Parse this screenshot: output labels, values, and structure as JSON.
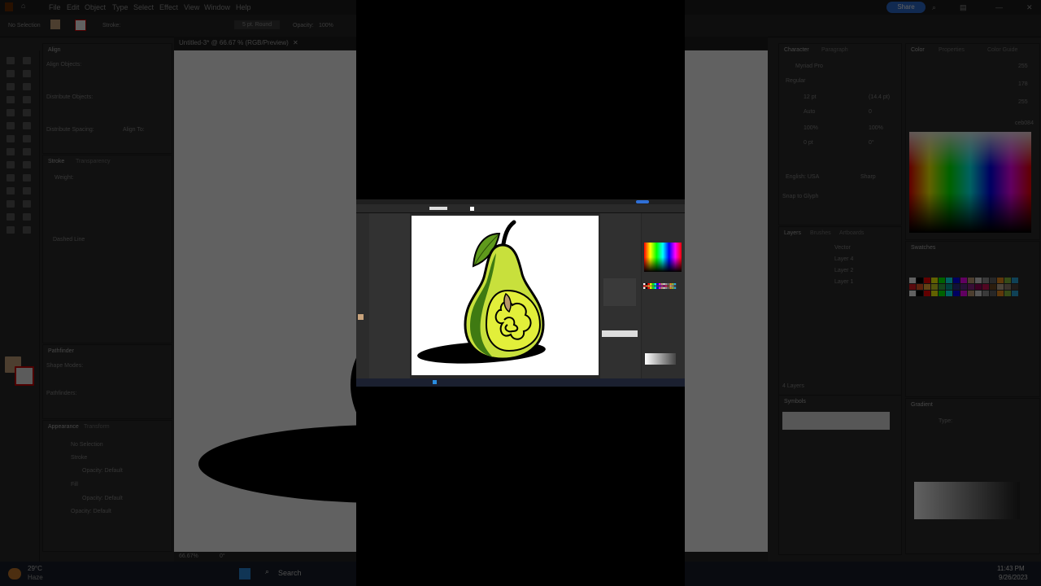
{
  "app": {
    "menu": [
      "File",
      "Edit",
      "Object",
      "Type",
      "Select",
      "Effect",
      "View",
      "Window",
      "Help"
    ],
    "share_label": "Share",
    "doc_tab": "Untitled-3* @ 66.67 % (RGB/Preview)",
    "selection_label": "No Selection",
    "stroke_label": "Stroke:",
    "brush_label": "5 pt. Round",
    "opacity_label": "Opacity:",
    "opacity_value": "100%"
  },
  "left_panels": {
    "align": {
      "title": "Align",
      "align_objects": "Align Objects:",
      "distribute_objects": "Distribute Objects:",
      "distribute_spacing": "Distribute Spacing:",
      "align_to": "Align To:"
    },
    "stroke": {
      "title": "Stroke",
      "tab2": "Transparency",
      "weight": "Weight:",
      "dashed_line": "Dashed Line"
    },
    "pathfinder": {
      "title": "Pathfinder",
      "shape_modes": "Shape Modes:",
      "pathfinders": "Pathfinders:"
    },
    "appearance": {
      "title": "Appearance",
      "tab2": "Transform",
      "no_selection": "No Selection",
      "stroke": "Stroke",
      "opacity1": "Opacity: Default",
      "fill": "Fill",
      "opacity2": "Opacity: Default",
      "opacity3": "Opacity: Default"
    }
  },
  "right_panels": {
    "character": {
      "title": "Character",
      "tab2": "Paragraph",
      "font": "Myriad Pro",
      "style": "Regular",
      "size": "12 pt",
      "leading": "(14.4 pt)",
      "tracking": "Auto",
      "kerning": "0",
      "scale_h": "100%",
      "scale_v": "100%",
      "baseline": "0 pt",
      "rotate": "0°",
      "language": "English: USA",
      "aa": "Sharp",
      "snap": "Snap to Glyph"
    },
    "layers": {
      "title": "Layers",
      "tab2": "Brushes",
      "tab3": "Artboards",
      "items": [
        "Vector",
        "Layer 4",
        "Layer 2",
        "Layer 1"
      ],
      "footer": "4 Layers"
    },
    "color": {
      "title": "Color",
      "tab2": "Properties",
      "tab3": "Color Guide",
      "r": "255",
      "g": "178",
      "b": "255",
      "hex": "ceb084"
    },
    "swatches": {
      "title": "Swatches"
    },
    "symbols": {
      "title": "Symbols"
    },
    "gradient": {
      "title": "Gradient",
      "type": "Type:"
    }
  },
  "status": {
    "zoom": "66.67%",
    "rotation": "0°"
  },
  "taskbar": {
    "weather_temp": "29°C",
    "weather_desc": "Haze",
    "search": "Search",
    "time": "11:43 PM",
    "date": "9/26/2023"
  },
  "colors": {
    "accent": "#2f6fd6",
    "pear_light": "#c8e03c",
    "pear_dark": "#3f7a12",
    "pear_core": "#e2ef3a",
    "leaf": "#5f9a1c",
    "fill_swatch": "#c8a37c"
  }
}
